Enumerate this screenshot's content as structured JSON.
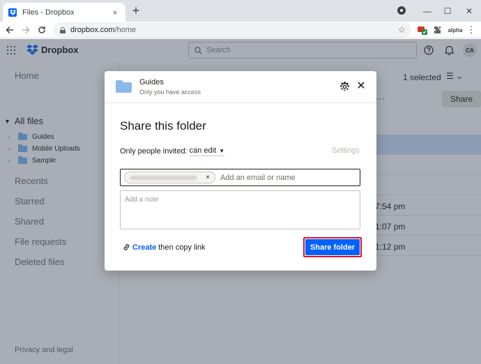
{
  "browser": {
    "tab_title": "Files - Dropbox",
    "close_glyph": "×",
    "new_tab_glyph": "+",
    "url_host": "dropbox.com",
    "url_path": "/home",
    "ext_label": "alpha",
    "window": {
      "minimize": "—",
      "maximize": "☐",
      "close": "✕"
    }
  },
  "app": {
    "logo_text": "Dropbox",
    "search_placeholder": "Search",
    "avatar_initials": "CA",
    "sidebar": {
      "home": "Home",
      "all_files": "All files",
      "tree": [
        {
          "label": "Guides"
        },
        {
          "label": "Mobile Uploads"
        },
        {
          "label": "Sample"
        }
      ],
      "links": [
        "Recents",
        "Starred",
        "Shared",
        "File requests",
        "Deleted files"
      ],
      "footer": "Privacy and legal"
    },
    "main": {
      "selected_count": "1 selected",
      "view_glyph": "☰ ⌄",
      "share_label": "Share",
      "more_glyph": "···",
      "row_times": [
        "7:54 pm",
        "1:07 pm",
        "1:12 pm"
      ]
    }
  },
  "modal": {
    "folder_name": "Guides",
    "folder_sub": "Only you have access",
    "close_glyph": "✕",
    "title": "Share this folder",
    "permission_label": "Only people invited:",
    "permission_value": "can edit",
    "settings_label": "Settings",
    "chip_remove": "×",
    "invite_placeholder": "Add an email or name",
    "note_placeholder": "Add a note",
    "create_link": "Create",
    "create_link_suffix": "then copy link",
    "share_button": "Share folder"
  },
  "icons": {
    "favicon": "dropbox-icon",
    "lock": "lock-icon",
    "star": "star-icon",
    "help": "help-icon",
    "bell": "bell-icon",
    "gear": "gear-icon",
    "link": "link-icon"
  },
  "colors": {
    "dropbox_blue": "#0061fe",
    "highlight_red": "#e0102a",
    "overlay": "rgba(50,63,82,0.42)"
  }
}
